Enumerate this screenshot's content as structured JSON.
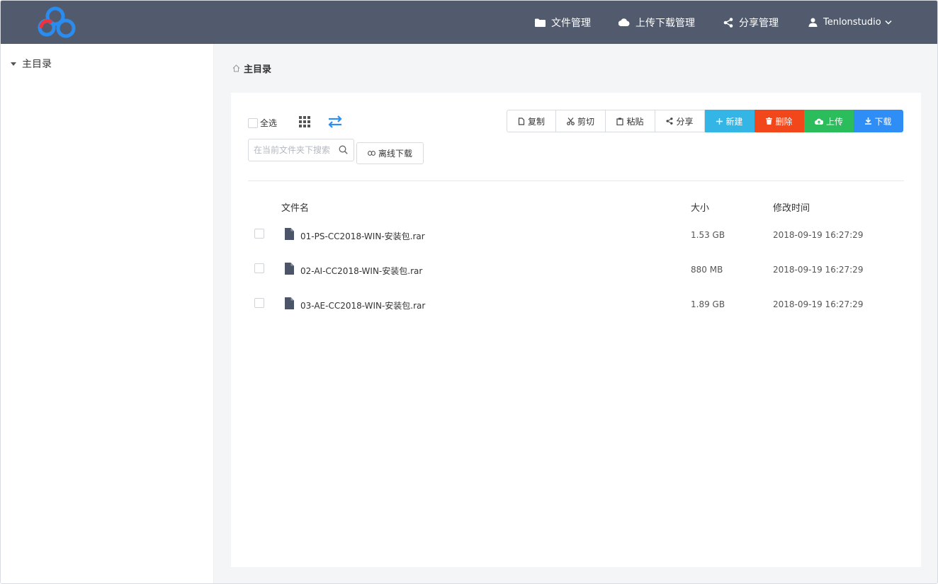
{
  "nav": {
    "file_mgmt": "文件管理",
    "transfer_mgmt": "上传下载管理",
    "share_mgmt": "分享管理",
    "user": "Tenlonstudio"
  },
  "sidebar": {
    "root": "主目录"
  },
  "breadcrumb": {
    "current": "主目录"
  },
  "toolbar": {
    "select_all": "全选",
    "copy": "复制",
    "cut": "剪切",
    "paste": "粘贴",
    "share": "分享",
    "new": "新建",
    "delete": "删除",
    "upload": "上传",
    "download": "下载",
    "search_placeholder": "在当前文件夹下搜索",
    "offline_download": "离线下载"
  },
  "table": {
    "headers": {
      "name": "文件名",
      "size": "大小",
      "modified": "修改时间"
    },
    "rows": [
      {
        "name": "01-PS-CC2018-WIN-安装包.rar",
        "size": "1.53 GB",
        "modified": "2018-09-19 16:27:29"
      },
      {
        "name": "02-AI-CC2018-WIN-安装包.rar",
        "size": "880 MB",
        "modified": "2018-09-19 16:27:29"
      },
      {
        "name": "03-AE-CC2018-WIN-安装包.rar",
        "size": "1.89 GB",
        "modified": "2018-09-19 16:27:29"
      }
    ]
  },
  "colors": {
    "topbar": "#525b6e",
    "new": "#33b5e5",
    "delete": "#f2461b",
    "upload": "#2bbd5c",
    "download": "#2f8ef5"
  },
  "icons": [
    "logo-icon",
    "folder-icon",
    "cloud-icon",
    "share-icon",
    "user-icon",
    "chevron-down-icon",
    "caret-down-icon",
    "home-icon",
    "grid-view-icon",
    "swap-icon",
    "copy-icon",
    "scissors-icon",
    "paste-icon",
    "plus-icon",
    "trash-icon",
    "cloud-upload-icon",
    "download-icon",
    "search-icon",
    "link-icon",
    "file-icon"
  ]
}
